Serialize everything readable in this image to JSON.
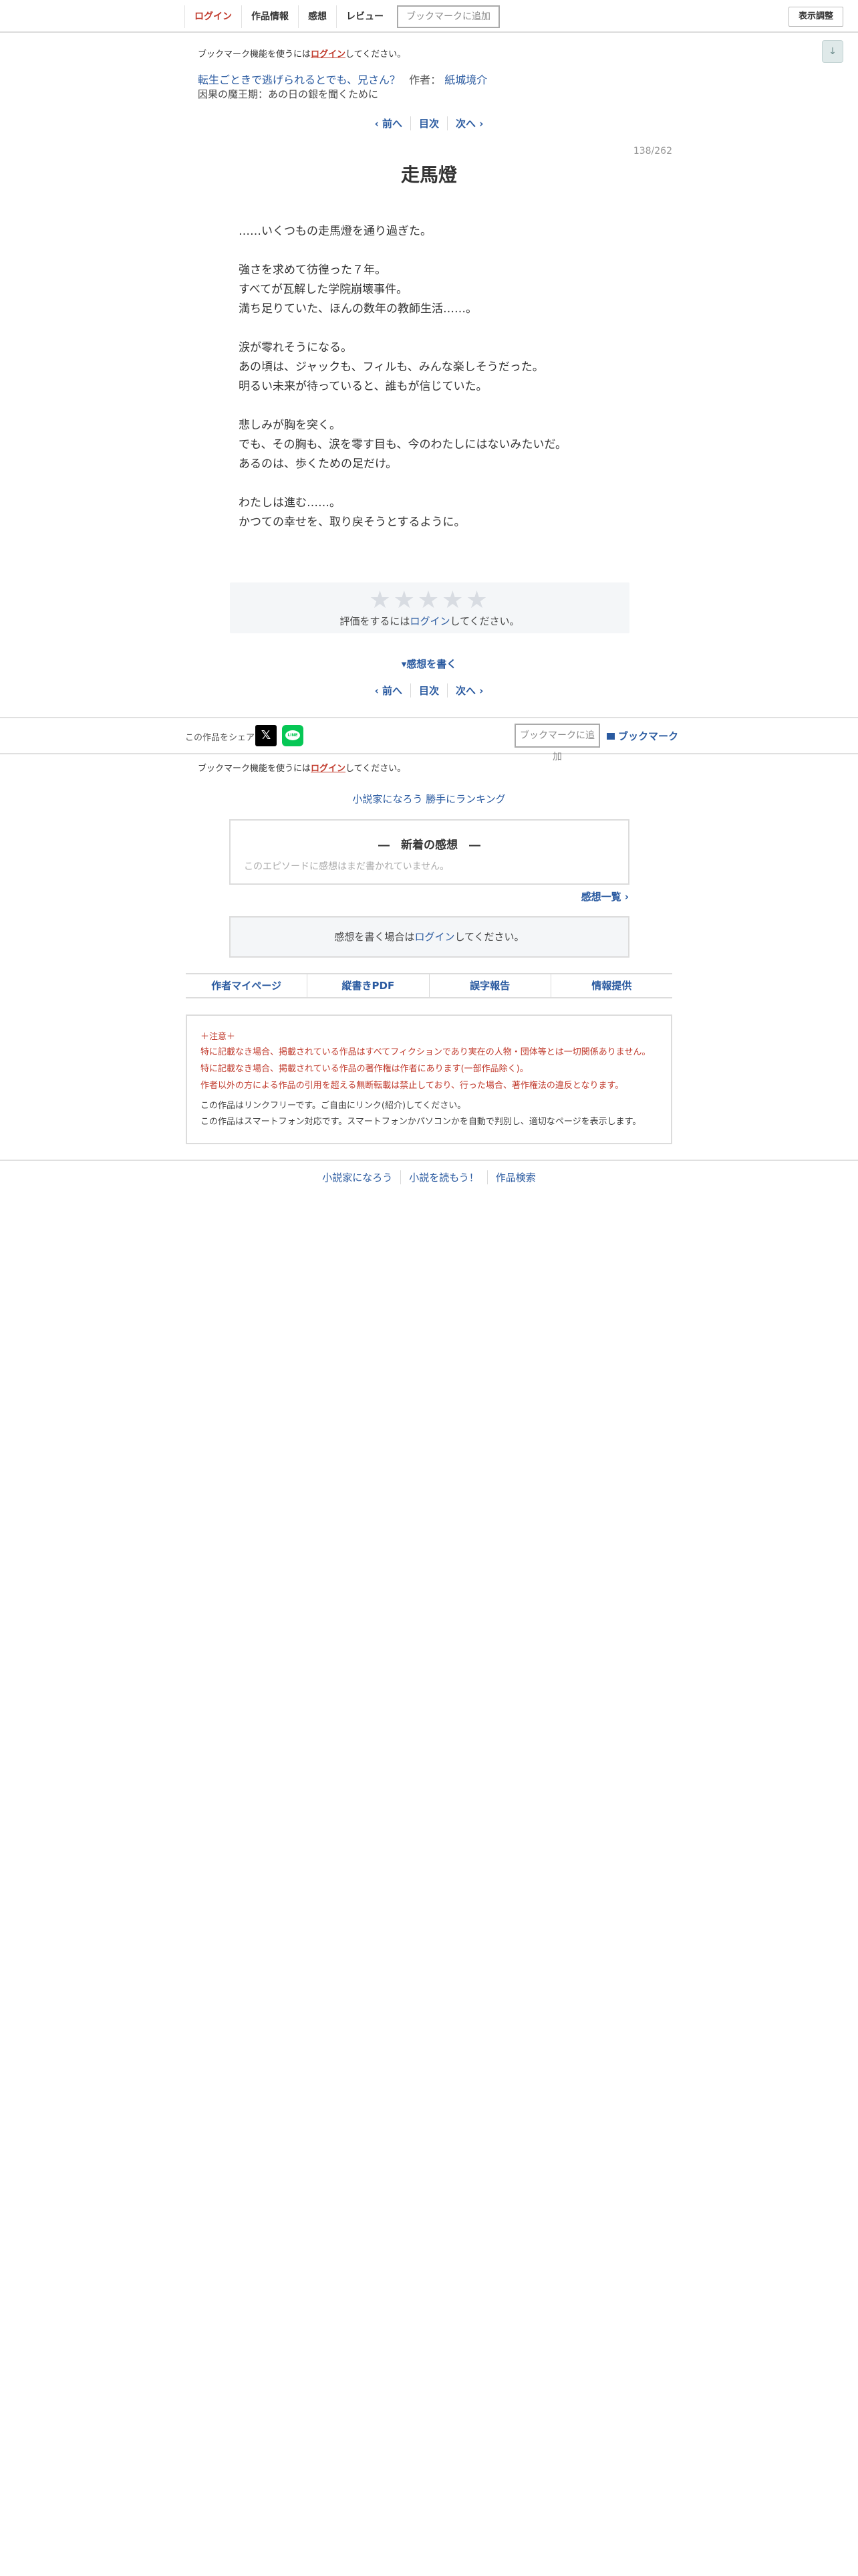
{
  "nav": {
    "login": "ログイン",
    "work_info": "作品情報",
    "impressions": "感想",
    "review": "レビュー",
    "bookmark_add": "ブックマークに追加",
    "display_settings": "表示調整",
    "down_arrow": "↓"
  },
  "bookmark_note": {
    "before": "ブックマーク機能を使うには",
    "link": "ログイン",
    "after": "してください。"
  },
  "series": {
    "title": "転生ごときで逃げられるとでも、兄さん？",
    "author_label": "作者：",
    "author": "紙城境介",
    "chapter": "因果の魔王期：あの日の銀を聞くために"
  },
  "pager": {
    "prev": "‹ 前へ",
    "toc": "目次",
    "next": "次へ ›"
  },
  "page_count": "138/262",
  "episode_title": "走馬燈",
  "body_lines": [
    "……いくつもの走馬燈を通り過ぎた。",
    "",
    "強さを求めて彷徨った７年。",
    "すべてが瓦解した学院崩壊事件。",
    "満ち足りていた、ほんの数年の教師生活……。",
    "",
    "涙が零れそうになる。",
    "あの頃は、ジャックも、フィルも、みんな楽しそうだった。",
    "明るい未来が待っていると、誰もが信じていた。",
    "",
    "悲しみが胸を突く。",
    "でも、その胸も、涙を零す目も、今のわたしにはないみたいだ。",
    "あるのは、歩くための足だけ。",
    "",
    "わたしは進む……。",
    "かつての幸せを、取り戻そうとするように。"
  ],
  "rating": {
    "stars": "★★★★★",
    "before": "評価をするには",
    "link": "ログイン",
    "after": "してください。"
  },
  "write_review": "▾感想を書く",
  "share": {
    "label": "この作品をシェア",
    "x_glyph": "𝕏",
    "line_glyph": "LINE",
    "bookmark_add": "ブックマークに追加",
    "bookmark": "ブックマーク"
  },
  "ranking": "小説家になろう 勝手にランキング",
  "latest": {
    "title": "―　新着の感想　―",
    "empty": "このエピソードに感想はまだ書かれていません。",
    "list_link": "感想一覧 ›"
  },
  "review_login": {
    "before": "感想を書く場合は",
    "link": "ログイン",
    "after": "してください。"
  },
  "foot_links": [
    "作者マイページ",
    "縦書きPDF",
    "誤字報告",
    "情報提供"
  ],
  "caution": {
    "title": "＋注意＋",
    "red_lines": [
      "特に記載なき場合、掲載されている作品はすべてフィクションであり実在の人物・団体等とは一切関係ありません。",
      "特に記載なき場合、掲載されている作品の著作権は作者にあります(一部作品除く)。",
      "作者以外の方による作品の引用を超える無断転載は禁止しており、行った場合、著作権法の違反となります。"
    ],
    "gray_lines": [
      "この作品はリンクフリーです。ご自由にリンク(紹介)してください。",
      "この作品はスマートフォン対応です。スマートフォンかパソコンかを自動で判別し、適切なページを表示します。"
    ]
  },
  "bottom_links": [
    "小説家になろう",
    "小説を読もう！",
    "作品検索"
  ]
}
